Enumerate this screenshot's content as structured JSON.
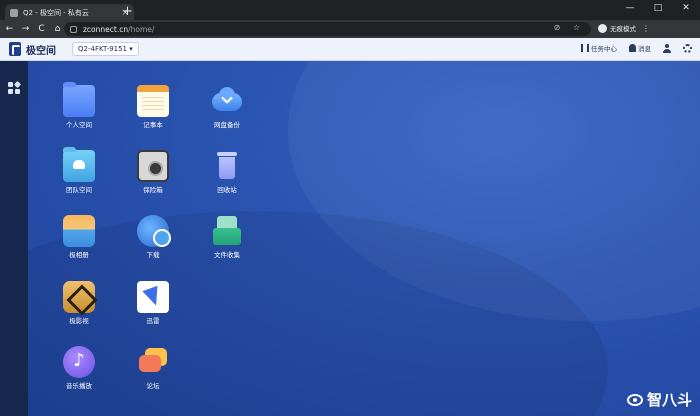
{
  "browser": {
    "tab_title": "Q2 - 极空间 - 私有云",
    "tab_close": "×",
    "new_tab": "+",
    "window_controls": [
      "—",
      "□",
      "✕"
    ],
    "nav": {
      "back": "←",
      "forward": "→",
      "reload": "C",
      "home": "⌂"
    },
    "url_host": "zconnect.cn",
    "url_path": "/home/",
    "address_icons": "⊘ ☆",
    "profile_label": "无痕模式",
    "menu_icon": "⋮"
  },
  "app_header": {
    "logo_text": "极空间",
    "device_name": "Q2-4FKT-9151 ▾",
    "task_center": "任务中心",
    "messages": "消息"
  },
  "apps": [
    {
      "label": "个人空间",
      "icon": "personal-space-folder-icon"
    },
    {
      "label": "记事本",
      "icon": "notepad-icon"
    },
    {
      "label": "网盘备份",
      "icon": "cloud-backup-icon"
    },
    {
      "label": "团队空间",
      "icon": "team-space-folder-icon"
    },
    {
      "label": "保险箱",
      "icon": "safe-icon"
    },
    {
      "label": "回收站",
      "icon": "recycle-bin-icon"
    },
    {
      "label": "极相册",
      "icon": "photo-album-icon"
    },
    {
      "label": "下载",
      "icon": "download-icon"
    },
    {
      "label": "文件收集",
      "icon": "file-collection-icon"
    },
    {
      "label": "极影视",
      "icon": "video-icon"
    },
    {
      "label": "迅雷",
      "icon": "xunlei-icon"
    },
    {
      "label": "音乐播放",
      "icon": "music-player-icon"
    },
    {
      "label": "论坛",
      "icon": "forum-icon"
    }
  ],
  "watermark": "智八斗"
}
